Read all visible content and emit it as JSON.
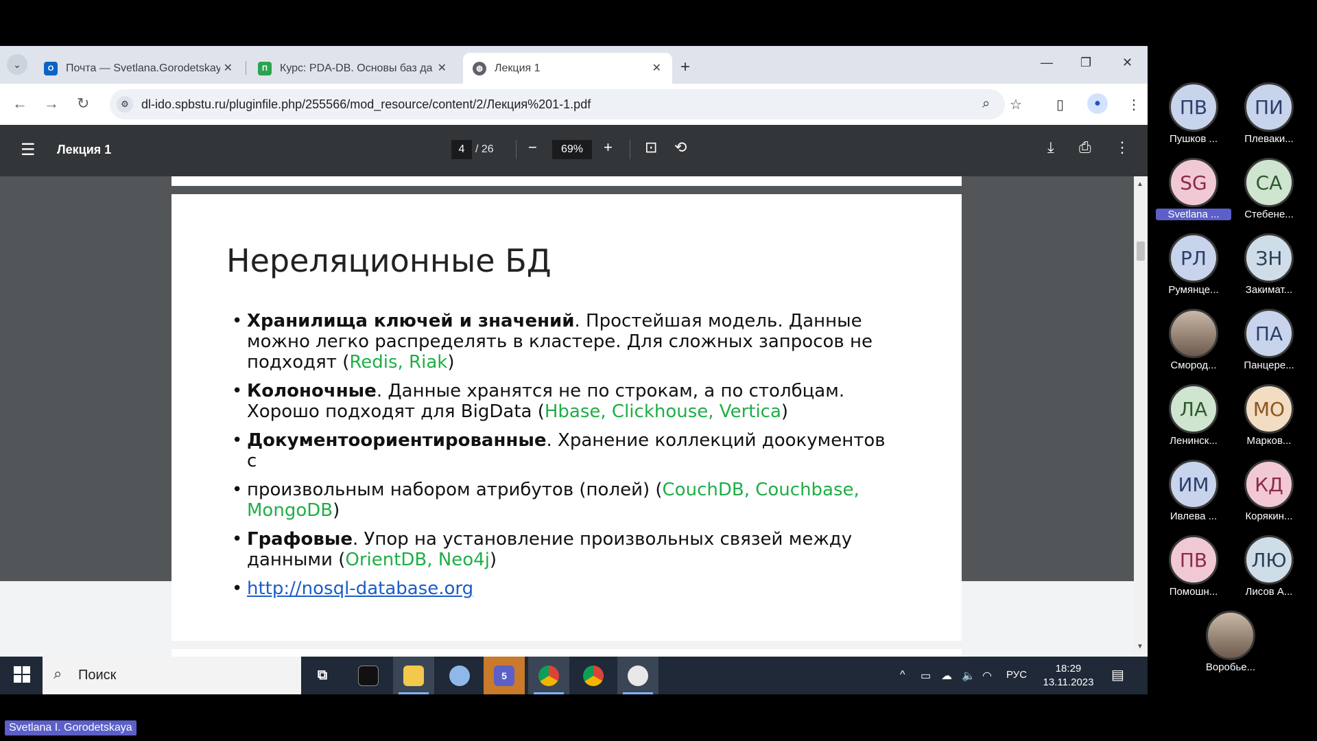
{
  "browser": {
    "tabs": [
      {
        "title": "Почта — Svetlana.Gorodetskaya",
        "favicon": "outlook-icon",
        "color": "#0a64c6"
      },
      {
        "title": "Курс: PDA-DB. Основы баз да",
        "favicon": "moodle-icon",
        "color": "#2aa44f"
      },
      {
        "title": "Лекция 1",
        "favicon": "globe-icon",
        "color": "#5f6368"
      }
    ],
    "url": "dl-ido.spbstu.ru/pluginfile.php/255566/mod_resource/content/2/Лекция%201-1.pdf"
  },
  "pdf": {
    "title": "Лекция 1",
    "page": "4",
    "total": "/ 26",
    "zoom": "69%"
  },
  "slide": {
    "title": "Нереляционные БД",
    "bullets": [
      {
        "bold": "Хранилища ключей и значений",
        "text": ". Простейшая модель. Данные можно легко распределять в кластере. Для сложных запросов не подходят (",
        "green": "Redis, Riak",
        "tail": ")"
      },
      {
        "bold": "Колоночные",
        "text": ". Данные хранятся не по строкам, а по столбцам. Хорошо подходят для BigData (",
        "green": "Hbase, Clickhouse, Vertica",
        "tail": ")"
      },
      {
        "bold": "Документоориентированные",
        "text": ". Хранение коллекций доокументов с",
        "green": "",
        "tail": ""
      },
      {
        "bold": "",
        "text": "произвольным набором атрибутов (полей) (",
        "green": "CouchDB, Couchbase, MongoDB",
        "tail": ")"
      },
      {
        "bold": "Графовые",
        "text": ". Упор на установление произвольных связей между данными (",
        "green": "OrientDB, Neo4j",
        "tail": ")"
      }
    ],
    "link": "http://nosql-database.org"
  },
  "taskbar": {
    "search_placeholder": "Поиск",
    "lang": "РУС",
    "time": "18:29",
    "date": "13.11.2023",
    "teams_badge": "5"
  },
  "participants": [
    {
      "initials": "ПВ",
      "name": "Пушков ...",
      "bg": "#c8d4ec",
      "fg": "#2c3e6b"
    },
    {
      "initials": "ПИ",
      "name": "Плеваки...",
      "bg": "#c8d4ec",
      "fg": "#2c3e6b"
    },
    {
      "initials": "SG",
      "name": "Svetlana ...",
      "bg": "#f1c9d4",
      "fg": "#8c2a4a"
    },
    {
      "initials": "СА",
      "name": "Стебене...",
      "bg": "#cfe5cf",
      "fg": "#2f5a2f"
    },
    {
      "initials": "РЛ",
      "name": "Румянце...",
      "bg": "#c8d4ec",
      "fg": "#2c3e6b"
    },
    {
      "initials": "ЗН",
      "name": "Закимат...",
      "bg": "#cfdde8",
      "fg": "#2a3f55"
    },
    {
      "initials": "",
      "name": "Смород...",
      "bg": "photo",
      "fg": ""
    },
    {
      "initials": "ПА",
      "name": "Панцере...",
      "bg": "#c8d4ec",
      "fg": "#2c3e6b"
    },
    {
      "initials": "ЛА",
      "name": "Ленинск...",
      "bg": "#cfe5cf",
      "fg": "#2f5a2f"
    },
    {
      "initials": "МО",
      "name": "Марков...",
      "bg": "#f2dcc2",
      "fg": "#8a5520"
    },
    {
      "initials": "ИМ",
      "name": "Ивлева ...",
      "bg": "#c8d4ec",
      "fg": "#2c3e6b"
    },
    {
      "initials": "КД",
      "name": "Корякин...",
      "bg": "#f1c9d4",
      "fg": "#8c2a4a"
    },
    {
      "initials": "ПВ",
      "name": "Помошн...",
      "bg": "#f1c9d4",
      "fg": "#8c2a4a"
    },
    {
      "initials": "ЛЮ",
      "name": "Лисов А...",
      "bg": "#cfdde8",
      "fg": "#2a3f55"
    },
    {
      "initials": "",
      "name": "Воробье...",
      "bg": "photo",
      "fg": ""
    }
  ],
  "speaker_label": "Svetlana I. Gorodetskaya"
}
